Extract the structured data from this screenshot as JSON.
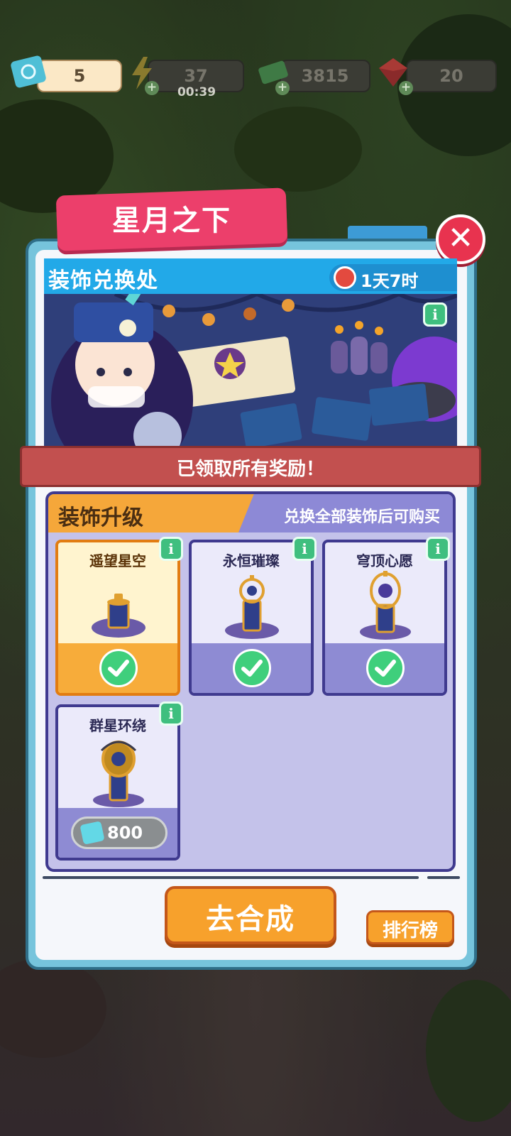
{
  "resources": {
    "tickets": "5",
    "energy": "37",
    "energy_timer": "00:39",
    "cash": "3815",
    "gems": "20"
  },
  "dialog": {
    "title": "星月之下",
    "close_icon": "close-icon"
  },
  "banner": {
    "label": "装饰兑换处",
    "countdown": "1天7时",
    "info_icon": "i"
  },
  "ribbon": "已领取所有奖励！",
  "upgrade": {
    "title": "装饰升级",
    "hint": "兑换全部装饰后可购买",
    "items": [
      {
        "name": "遥望星空",
        "state": "claimed",
        "info": "i"
      },
      {
        "name": "永恒璀璨",
        "state": "claimed",
        "info": "i"
      },
      {
        "name": "穹顶心愿",
        "state": "claimed",
        "info": "i"
      },
      {
        "name": "群星环绕",
        "state": "locked",
        "price": "800",
        "info": "i"
      }
    ]
  },
  "buttons": {
    "go": "去合成",
    "rank": "排行榜"
  },
  "colors": {
    "accent_pink": "#ec3f6b",
    "panel_blue": "#76c4dc",
    "orange": "#f7a12c",
    "purple": "#3f3a8f",
    "check_green": "#3fcf7c"
  }
}
